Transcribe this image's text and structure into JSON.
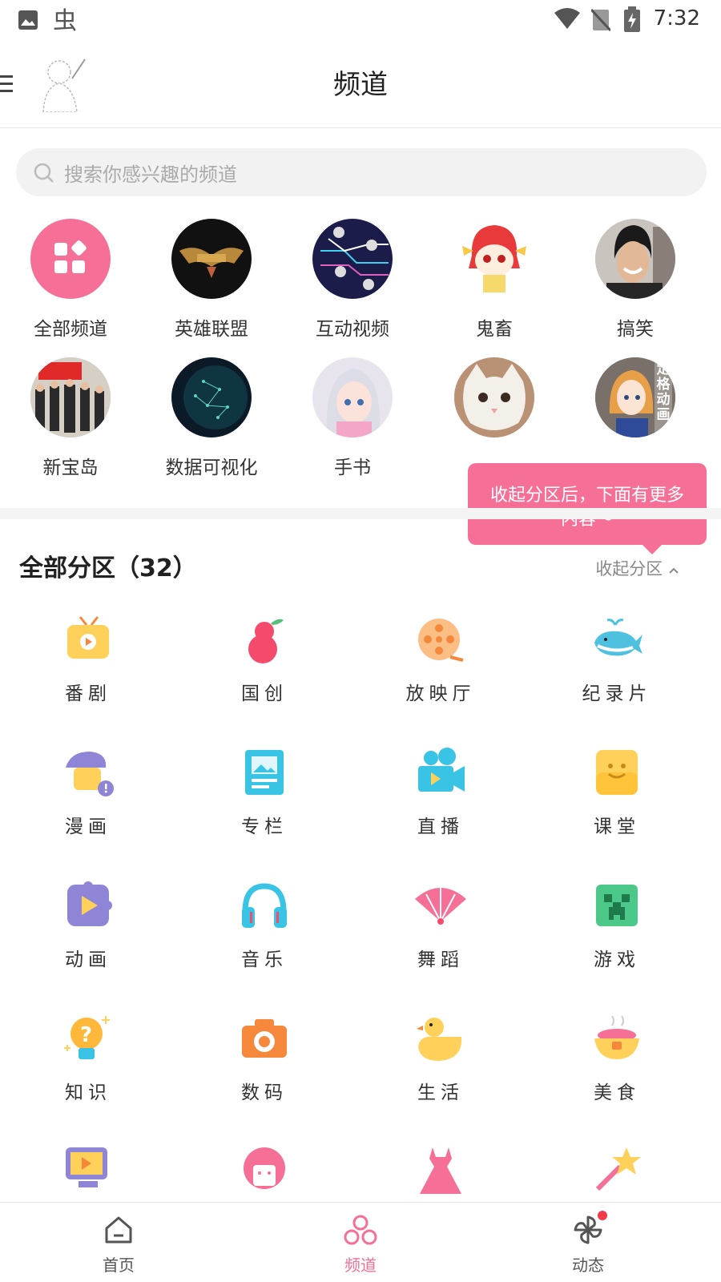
{
  "status_bar": {
    "time": "7:32"
  },
  "header": {
    "title": "频道"
  },
  "search": {
    "placeholder": "搜索你感兴趣的频道"
  },
  "channels": [
    {
      "label": "全部频道",
      "icon": "apps-icon"
    },
    {
      "label": "英雄联盟",
      "icon": "lol-logo"
    },
    {
      "label": "互动视频",
      "icon": "interactive-icon"
    },
    {
      "label": "鬼畜",
      "icon": "ghost-mascot"
    },
    {
      "label": "搞笑",
      "icon": "funny-face"
    },
    {
      "label": "新宝岛",
      "icon": "group-photo"
    },
    {
      "label": "数据可视化",
      "icon": "globe-network"
    },
    {
      "label": "手书",
      "icon": "anime-girl"
    },
    {
      "label": "",
      "icon": "cat-face"
    },
    {
      "label": "",
      "icon": "figure-doll"
    }
  ],
  "badge_text": "定格动画",
  "section": {
    "title": "全部分区（32）",
    "collapse_label": "收起分区"
  },
  "tooltip": {
    "text": "收起分区后，下面有更多内容～"
  },
  "categories": [
    {
      "label": "番剧",
      "icon": "tv-icon"
    },
    {
      "label": "国创",
      "icon": "gourd-icon"
    },
    {
      "label": "放映厅",
      "icon": "film-reel-icon"
    },
    {
      "label": "纪录片",
      "icon": "whale-icon"
    },
    {
      "label": "漫画",
      "icon": "beret-icon"
    },
    {
      "label": "专栏",
      "icon": "article-icon"
    },
    {
      "label": "直播",
      "icon": "camera-icon"
    },
    {
      "label": "课堂",
      "icon": "classroom-icon"
    },
    {
      "label": "动画",
      "icon": "play-puzzle-icon"
    },
    {
      "label": "音乐",
      "icon": "headphones-icon"
    },
    {
      "label": "舞蹈",
      "icon": "fan-icon"
    },
    {
      "label": "游戏",
      "icon": "creeper-icon"
    },
    {
      "label": "知识",
      "icon": "bulb-icon"
    },
    {
      "label": "数码",
      "icon": "photo-camera-icon"
    },
    {
      "label": "生活",
      "icon": "duck-icon"
    },
    {
      "label": "美食",
      "icon": "food-bowl-icon"
    }
  ],
  "tabbar": [
    {
      "label": "首页",
      "icon": "home-icon"
    },
    {
      "label": "频道",
      "icon": "channel-icon"
    },
    {
      "label": "动态",
      "icon": "pinwheel-icon"
    }
  ],
  "colors": {
    "accent": "#f56f96",
    "tooltip_bg": "#f56f96"
  }
}
